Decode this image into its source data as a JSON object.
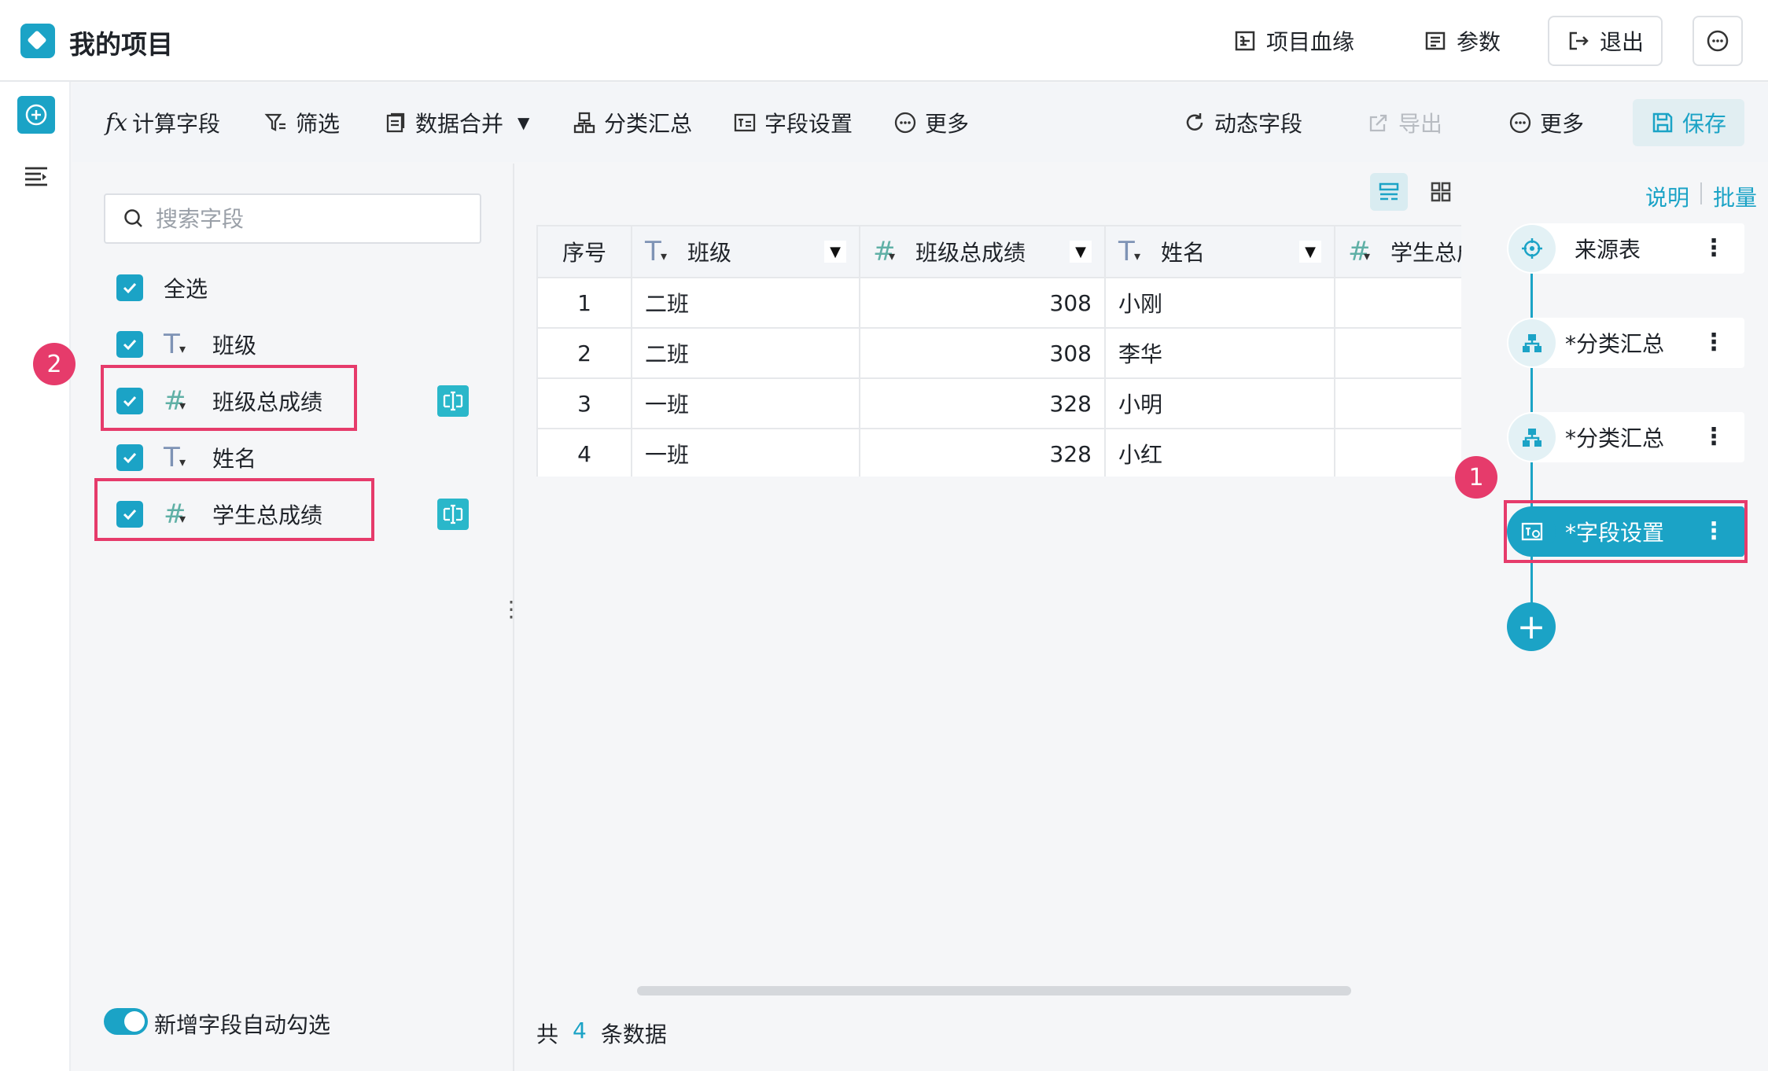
{
  "app": {
    "title": "我的项目"
  },
  "topbar": {
    "lineage_label": "项目血缘",
    "params_label": "参数",
    "exit_label": "退出"
  },
  "toolbar": {
    "calc_field": "计算字段",
    "filter": "筛选",
    "merge": "数据合并",
    "group_summary": "分类汇总",
    "field_settings": "字段设置",
    "more_left": "更多",
    "dynamic_field": "动态字段",
    "export": "导出",
    "more_right": "更多",
    "save": "保存"
  },
  "field_panel": {
    "search_placeholder": "搜索字段",
    "select_all": "全选",
    "fields": [
      {
        "name": "班级",
        "type": "text",
        "checked": true
      },
      {
        "name": "班级总成绩",
        "type": "number",
        "checked": true,
        "highlighted": true
      },
      {
        "name": "姓名",
        "type": "text",
        "checked": true
      },
      {
        "name": "学生总成绩",
        "type": "number",
        "checked": true,
        "highlighted": true
      }
    ],
    "auto_select_label": "新增字段自动勾选",
    "auto_select_on": true,
    "badge": "2"
  },
  "table": {
    "headers": [
      "序号",
      "班级",
      "班级总成绩",
      "姓名",
      "学生总成"
    ],
    "rows": [
      [
        "1",
        "二班",
        "308",
        "小刚",
        ""
      ],
      [
        "2",
        "二班",
        "308",
        "李华",
        ""
      ],
      [
        "3",
        "一班",
        "328",
        "小明",
        ""
      ],
      [
        "4",
        "一班",
        "328",
        "小红",
        ""
      ]
    ],
    "footer_prefix": "共",
    "footer_count": "4",
    "footer_suffix": "条数据"
  },
  "flow": {
    "help_label": "说明",
    "batch_label": "批量",
    "nodes": [
      {
        "label": "来源表"
      },
      {
        "label": "*分类汇总"
      },
      {
        "label": "*分类汇总"
      },
      {
        "label": "*字段设置",
        "active": true
      }
    ],
    "badge": "1"
  },
  "colors": {
    "accent": "#1ba3c6",
    "highlight": "#e63b6b"
  },
  "icons": [
    "app-logo-icon",
    "lineage-icon",
    "params-icon",
    "exit-icon",
    "more-circle-icon",
    "add-circle-icon",
    "list-icon",
    "fx-icon",
    "filter-icon",
    "merge-icon",
    "group-icon",
    "field-settings-icon",
    "refresh-icon",
    "export-icon",
    "save-icon",
    "search-icon",
    "checkbox-icon",
    "rename-icon",
    "list-view-icon",
    "grid-view-icon",
    "source-node-icon",
    "group-node-icon",
    "field-node-icon",
    "plus-icon"
  ]
}
